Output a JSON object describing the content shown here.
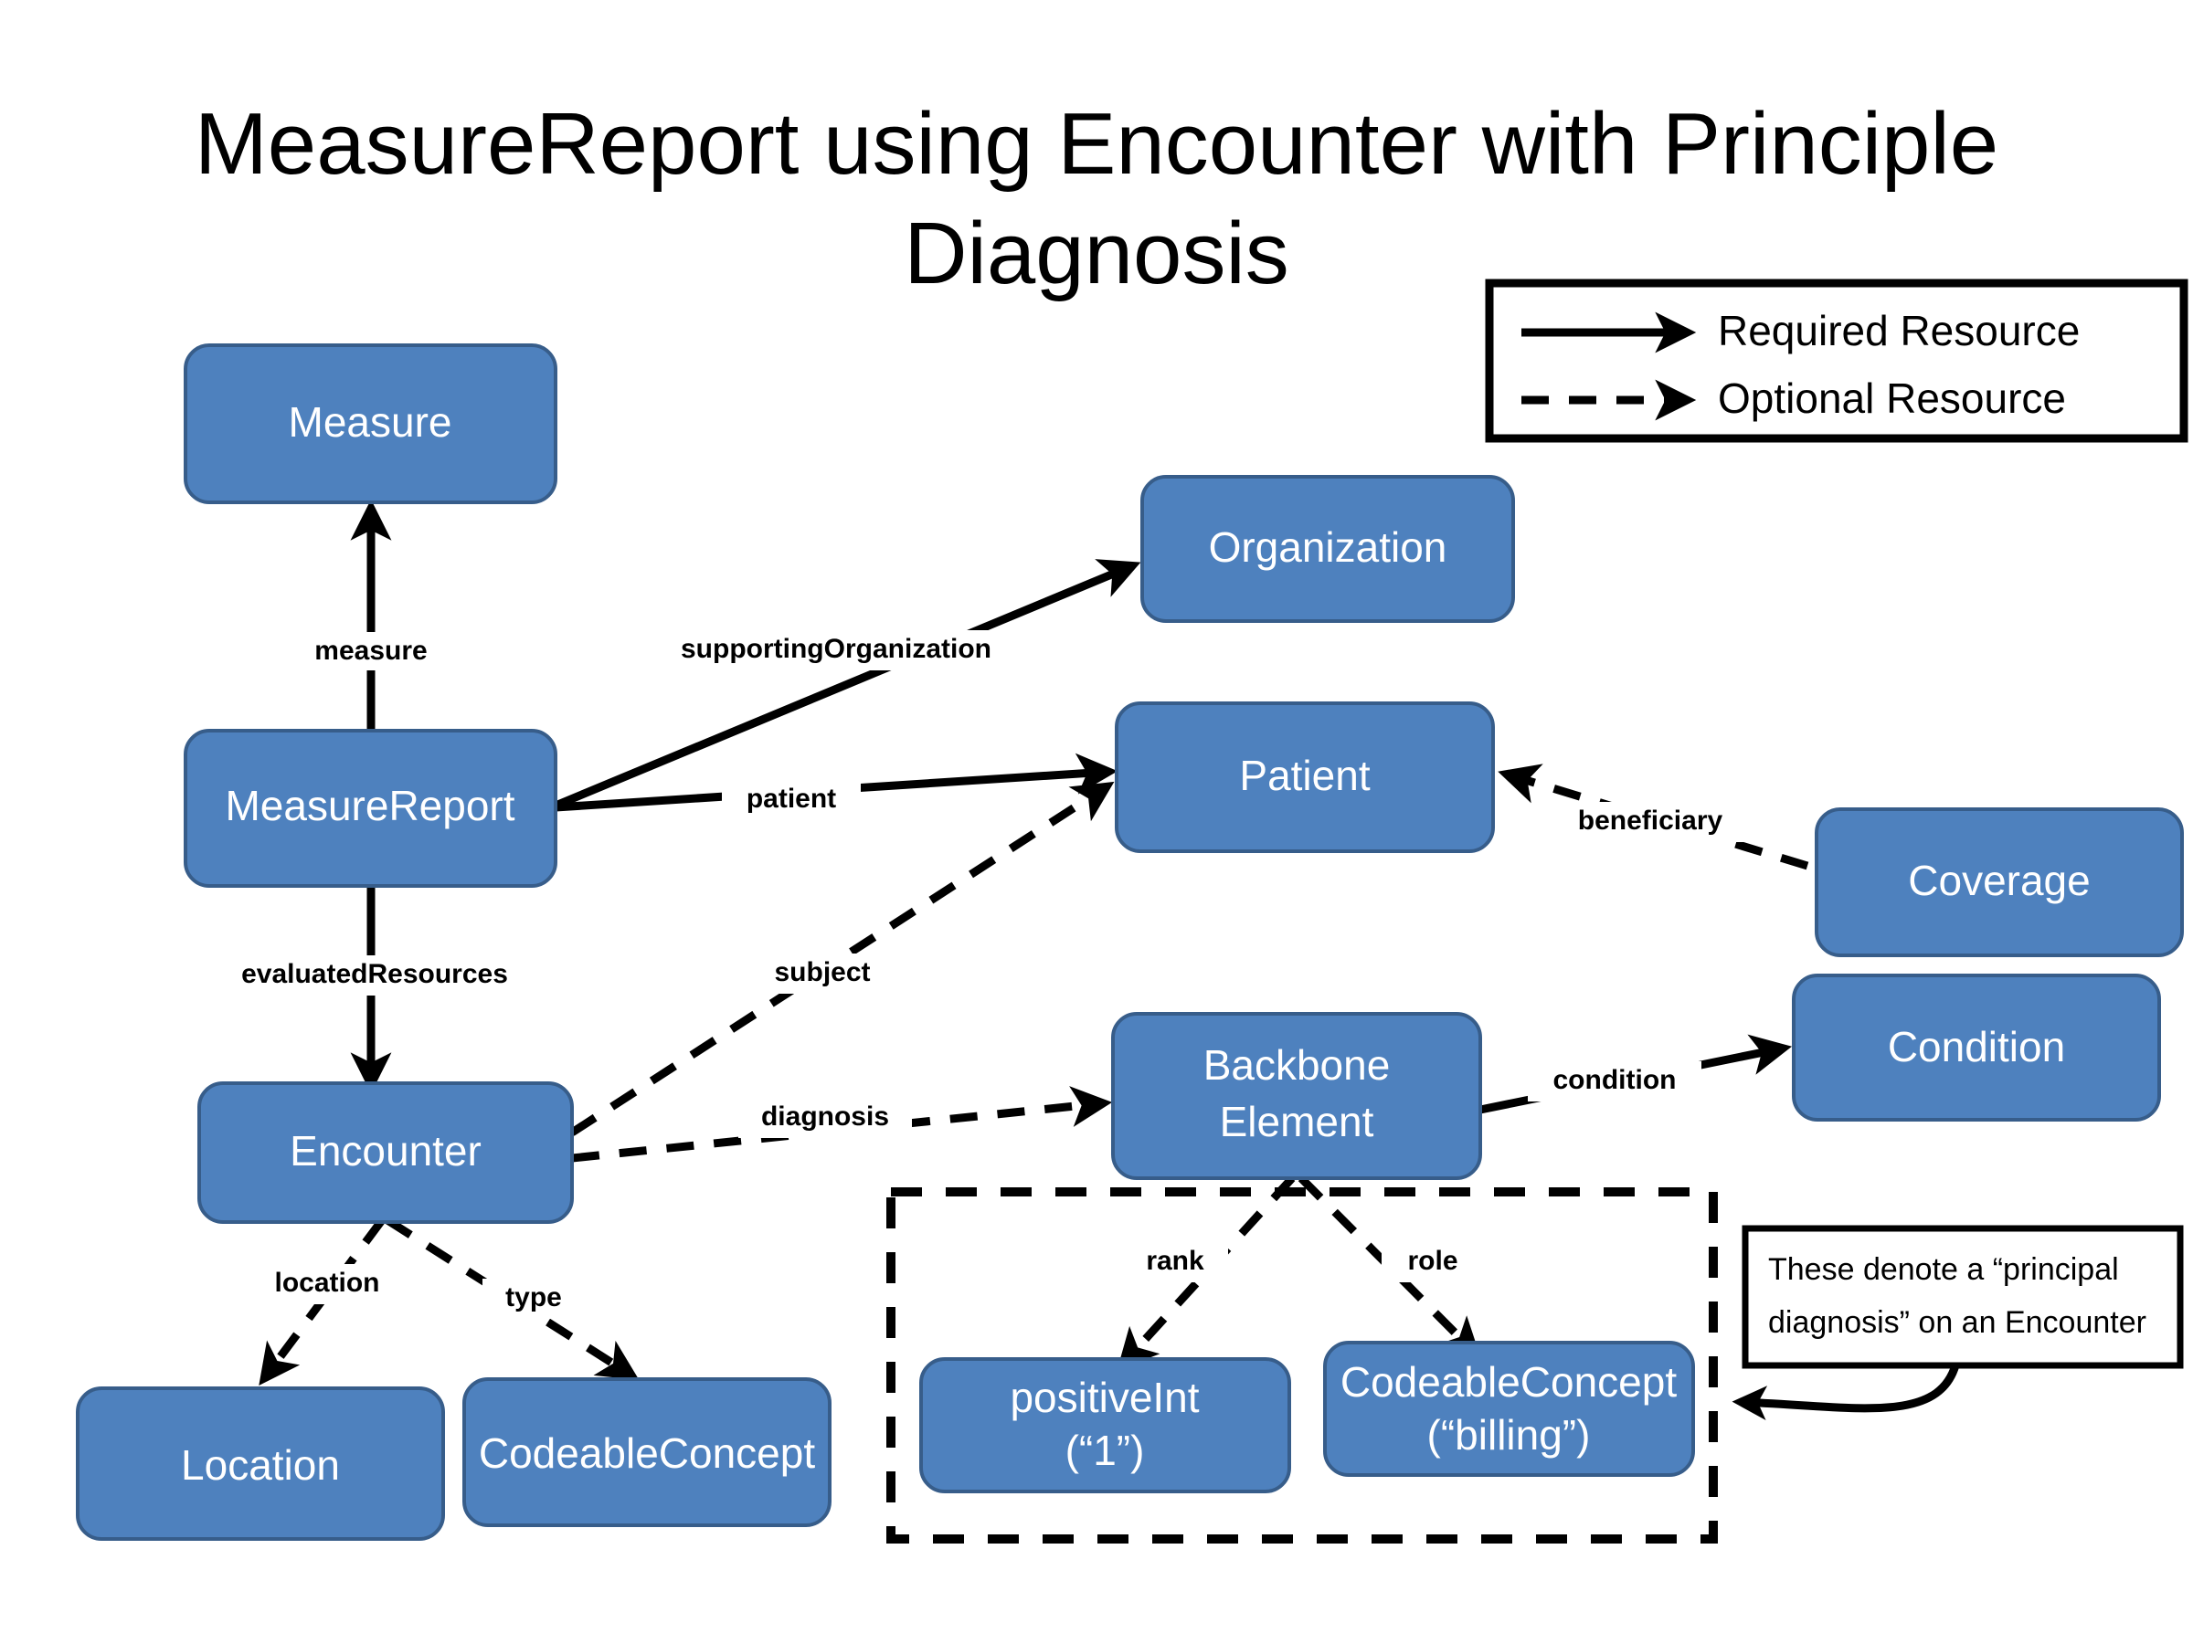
{
  "title": {
    "line1": "MeasureReport using Encounter with Principle",
    "line2": "Diagnosis"
  },
  "colors": {
    "node_fill": "#4E81BE",
    "node_stroke": "#375D8A",
    "edge": "#000000",
    "node_text": "#FFFFFF",
    "background": "#FFFFFF"
  },
  "legend": {
    "items": [
      {
        "label": "Required Resource",
        "style": "solid"
      },
      {
        "label": "Optional Resource",
        "style": "dashed"
      }
    ]
  },
  "nodes": [
    {
      "id": "measure",
      "label": "Measure",
      "line2": ""
    },
    {
      "id": "measurereport",
      "label": "MeasureReport",
      "line2": ""
    },
    {
      "id": "encounter",
      "label": "Encounter",
      "line2": ""
    },
    {
      "id": "organization",
      "label": "Organization",
      "line2": ""
    },
    {
      "id": "patient",
      "label": "Patient",
      "line2": ""
    },
    {
      "id": "coverage",
      "label": "Coverage",
      "line2": ""
    },
    {
      "id": "condition",
      "label": "Condition",
      "line2": ""
    },
    {
      "id": "backboneelement",
      "label": "Backbone",
      "line2": "Element"
    },
    {
      "id": "location",
      "label": "Location",
      "line2": ""
    },
    {
      "id": "codeableconcept",
      "label": "CodeableConcept",
      "line2": ""
    },
    {
      "id": "positiveint",
      "label": "positiveInt",
      "line2": "(“1”)"
    },
    {
      "id": "codeablebilling",
      "label": "CodeableConcept",
      "line2": "(“billing”)"
    }
  ],
  "edges": [
    {
      "id": "measure",
      "label": "measure",
      "style": "solid",
      "from": "measurereport",
      "to": "measure"
    },
    {
      "id": "supportingorganization",
      "label": "supportingOrganization",
      "style": "solid",
      "from": "measurereport",
      "to": "organization"
    },
    {
      "id": "patient",
      "label": "patient",
      "style": "solid",
      "from": "measurereport",
      "to": "patient"
    },
    {
      "id": "evaluatedresources",
      "label": "evaluatedResources",
      "style": "solid",
      "from": "measurereport",
      "to": "encounter"
    },
    {
      "id": "subject",
      "label": "subject",
      "style": "dashed",
      "from": "encounter",
      "to": "patient"
    },
    {
      "id": "diagnosis",
      "label": "diagnosis",
      "style": "dashed",
      "from": "encounter",
      "to": "backboneelement"
    },
    {
      "id": "beneficiary",
      "label": "beneficiary",
      "style": "dashed",
      "from": "coverage",
      "to": "patient"
    },
    {
      "id": "condition",
      "label": "condition",
      "style": "solid",
      "from": "backboneelement",
      "to": "condition"
    },
    {
      "id": "location",
      "label": "location",
      "style": "dashed",
      "from": "encounter",
      "to": "location"
    },
    {
      "id": "type",
      "label": "type",
      "style": "dashed",
      "from": "encounter",
      "to": "codeableconcept"
    },
    {
      "id": "rank",
      "label": "rank",
      "style": "dashed",
      "from": "backboneelement",
      "to": "positiveint"
    },
    {
      "id": "role",
      "label": "role",
      "style": "dashed",
      "from": "backboneelement",
      "to": "codeablebilling"
    }
  ],
  "callout": {
    "line1": "These denote a “principal",
    "line2": "diagnosis” on an Encounter"
  }
}
